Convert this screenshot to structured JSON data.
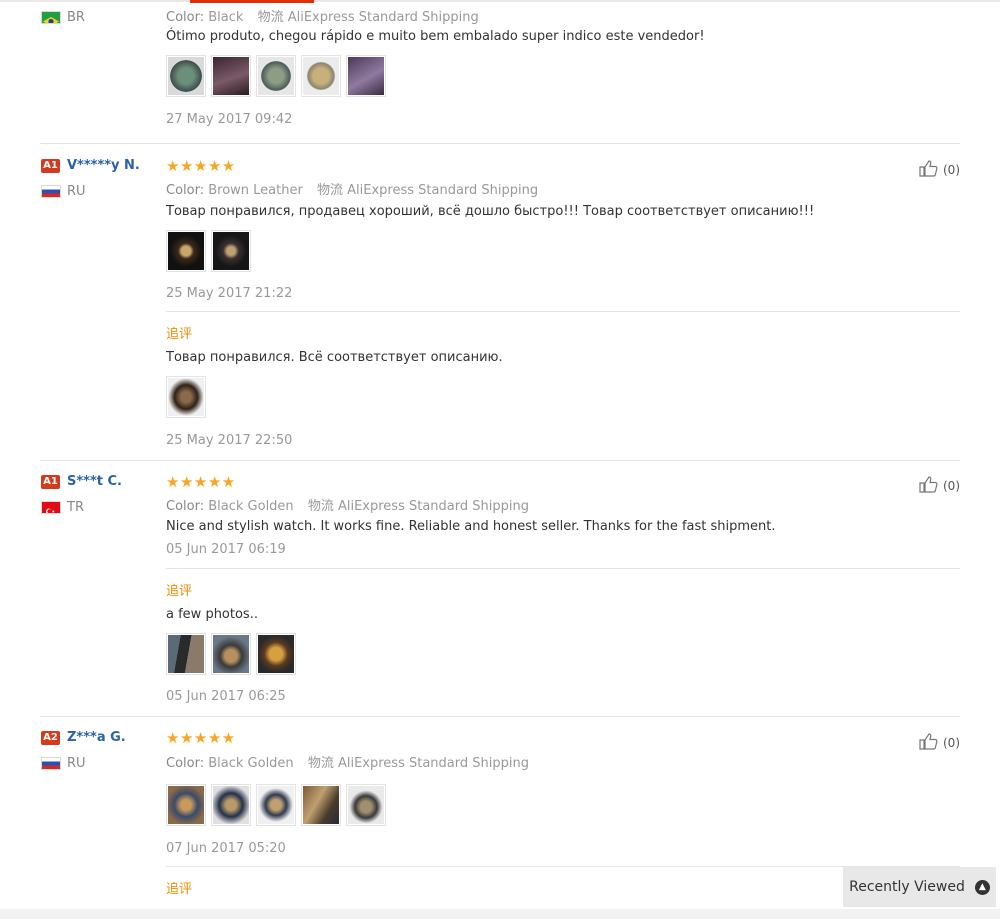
{
  "labels": {
    "color": "Color:",
    "shipping_prefix": "物流",
    "followup": "追评"
  },
  "review1": {
    "country": "BR",
    "color_value": "Black",
    "shipping": "AliExpress Standard Shipping",
    "text": "Ótimo produto, chegou rápido e muito bem embalado super indico este vendedor!",
    "date": "27 May 2017 09:42"
  },
  "review2": {
    "level": "A1",
    "name": "V*****y N.",
    "country": "RU",
    "rating": 5,
    "stars": "★★★★★",
    "helpful": "(0)",
    "color_value": "Brown Leather",
    "shipping": "AliExpress Standard Shipping",
    "text": "Товар понравился, продавец хороший, всё дошло быстро!!! Товар соответствует описанию!!!",
    "date": "25 May 2017 21:22",
    "followup_text": "Товар понравился. Всё соответствует описанию.",
    "followup_date": "25 May 2017 22:50"
  },
  "review3": {
    "level": "A1",
    "name": "S***t C.",
    "country": "TR",
    "rating": 5,
    "stars": "★★★★★",
    "helpful": "(0)",
    "color_value": "Black Golden",
    "shipping": "AliExpress Standard Shipping",
    "text": "Nice and stylish watch. It works fine. Reliable and honest seller. Thanks for the fast shipment.",
    "date": "05 Jun 2017 06:19",
    "followup_text": "a few photos..",
    "followup_date": "05 Jun 2017 06:25"
  },
  "review4": {
    "level": "A2",
    "name": "Z***a G.",
    "country": "RU",
    "rating": 5,
    "stars": "★★★★★",
    "helpful": "(0)",
    "color_value": "Black Golden",
    "shipping": "AliExpress Standard Shipping",
    "date": "07 Jun 2017 05:20"
  },
  "recently_viewed": "Recently Viewed",
  "icons": {
    "helpful": "thumbs-up-icon",
    "recently_viewed": "chevron-up-icon"
  },
  "colors": {
    "accent": "#e62e04",
    "link": "#2962a8",
    "star": "#f5a623",
    "followup": "#f08c00"
  }
}
